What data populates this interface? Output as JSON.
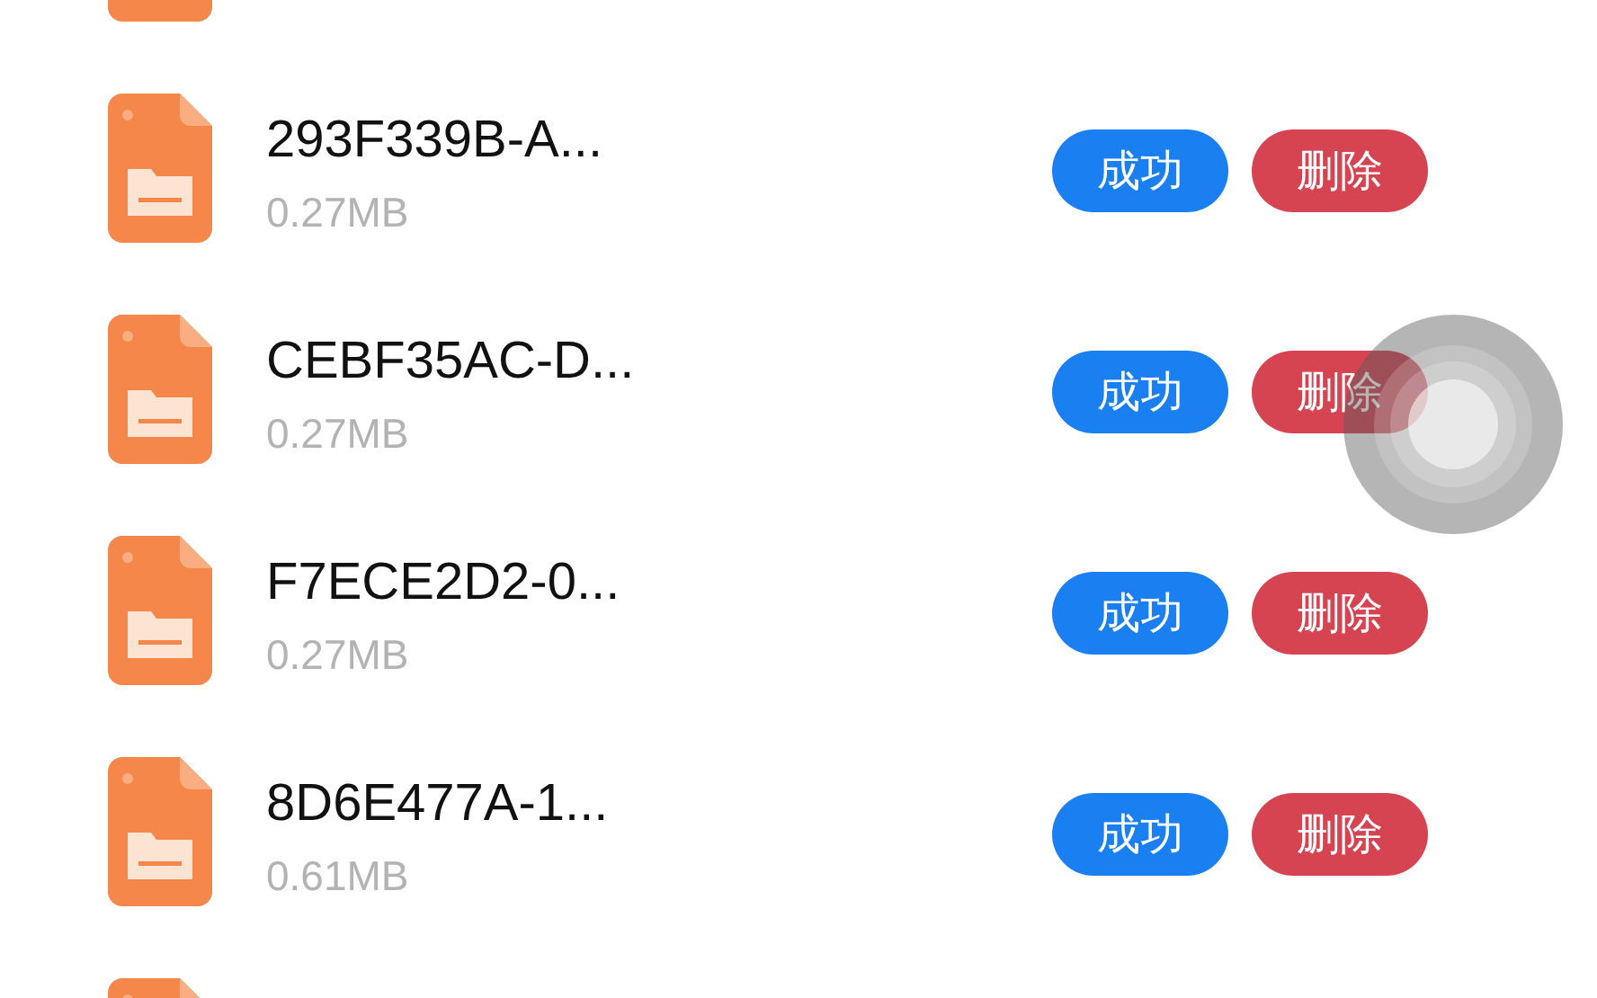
{
  "files": [
    {
      "kind": "file"
    },
    {
      "kind": "file",
      "name": "293F339B-A...",
      "size": "0.27MB",
      "status": "成功",
      "action": "删除"
    },
    {
      "kind": "file",
      "name": "CEBF35AC-D...",
      "size": "0.27MB",
      "status": "成功",
      "action": "删除"
    },
    {
      "kind": "file",
      "name": "F7ECE2D2-0...",
      "size": "0.27MB",
      "status": "成功",
      "action": "删除"
    },
    {
      "kind": "file",
      "name": "8D6E477A-1...",
      "size": "0.61MB",
      "status": "成功",
      "action": "删除"
    },
    {
      "kind": "file"
    }
  ],
  "floating_button": {
    "shown": true
  }
}
